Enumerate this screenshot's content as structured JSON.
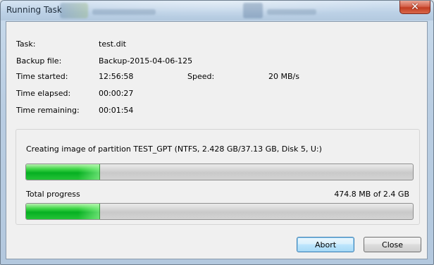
{
  "window": {
    "title": "Running Task"
  },
  "info": {
    "task_label": "Task:",
    "task_value": "test.dit",
    "backup_label": "Backup file:",
    "backup_value": "Backup-2015-04-06-125",
    "started_label": "Time started:",
    "started_value": "12:56:58",
    "speed_label": "Speed:",
    "speed_value": "20 MB/s",
    "elapsed_label": "Time elapsed:",
    "elapsed_value": "00:00:27",
    "remaining_label": "Time remaining:",
    "remaining_value": "00:01:54"
  },
  "progress": {
    "operation_text": "Creating image of partition TEST_GPT (NTFS, 2.428 GB/37.13 GB, Disk 5, U:)",
    "partition_fraction": 0.19,
    "total_label": "Total progress",
    "total_value": "474.8 MB of 2.4 GB",
    "total_fraction": 0.19
  },
  "buttons": {
    "abort": "Abort",
    "close": "Close"
  },
  "icons": {
    "close": "close-icon"
  },
  "colors": {
    "progress_fill": "#06b022",
    "close_button": "#c13d22"
  }
}
